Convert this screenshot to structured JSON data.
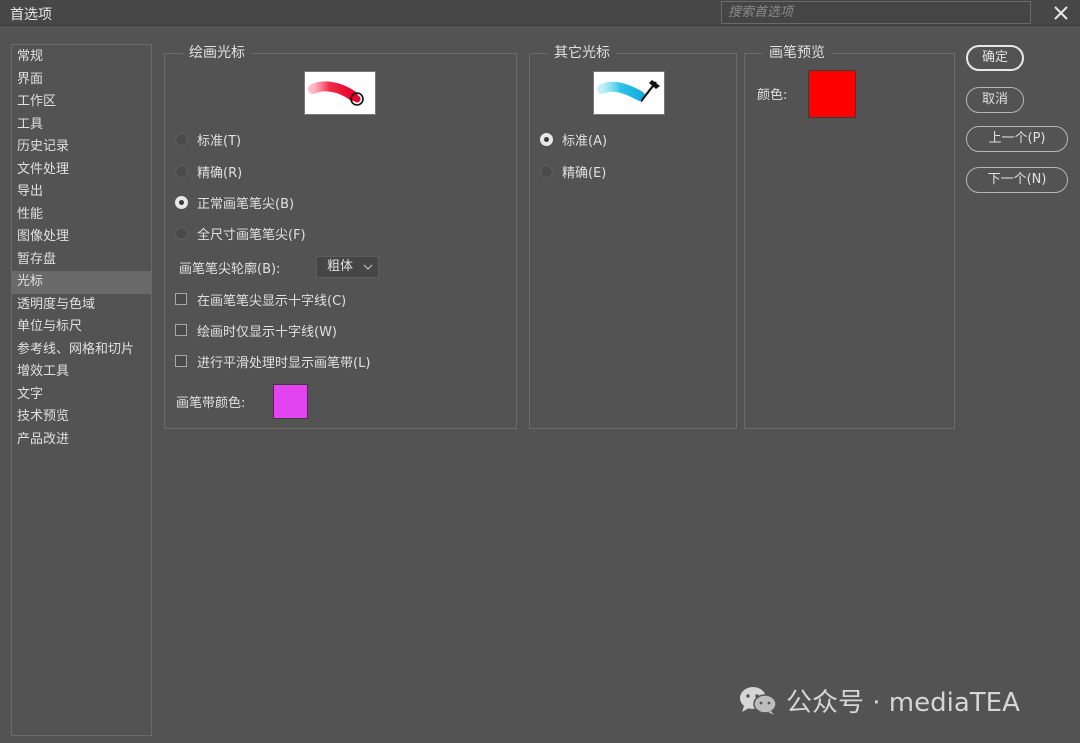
{
  "window": {
    "title": "首选项",
    "search_placeholder": "搜索首选项"
  },
  "sidebar": {
    "items": [
      {
        "label": "常规"
      },
      {
        "label": "界面"
      },
      {
        "label": "工作区"
      },
      {
        "label": "工具"
      },
      {
        "label": "历史记录"
      },
      {
        "label": "文件处理"
      },
      {
        "label": "导出"
      },
      {
        "label": "性能"
      },
      {
        "label": "图像处理"
      },
      {
        "label": "暂存盘"
      },
      {
        "label": "光标",
        "selected": true
      },
      {
        "label": "透明度与色域"
      },
      {
        "label": "单位与标尺"
      },
      {
        "label": "参考线、网格和切片"
      },
      {
        "label": "增效工具"
      },
      {
        "label": "文字"
      },
      {
        "label": "技术预览"
      },
      {
        "label": "产品改进"
      }
    ]
  },
  "painting_cursors": {
    "title": "绘画光标",
    "preview_icon": "brush-stroke-preview-red",
    "options": [
      {
        "label": "标准(T)",
        "checked": false
      },
      {
        "label": "精确(R)",
        "checked": false
      },
      {
        "label": "正常画笔笔尖(B)",
        "checked": true
      },
      {
        "label": "全尺寸画笔笔尖(F)",
        "checked": false
      }
    ],
    "brush_tip_outline_label": "画笔笔尖轮廓(B):",
    "brush_tip_outline_value": "粗体",
    "checkboxes": [
      {
        "label": "在画笔笔尖显示十字线(C)",
        "checked": false
      },
      {
        "label": "绘画时仅显示十字线(W)",
        "checked": false
      },
      {
        "label": "进行平滑处理时显示画笔带(L)",
        "checked": false
      }
    ],
    "brush_leash_color_label": "画笔带颜色:",
    "brush_leash_color": "#e245f0"
  },
  "other_cursors": {
    "title": "其它光标",
    "preview_icon": "eyedropper-stroke-preview-cyan",
    "options": [
      {
        "label": "标准(A)",
        "checked": true
      },
      {
        "label": "精确(E)",
        "checked": false
      }
    ]
  },
  "brush_preview": {
    "title": "画笔预览",
    "color_label": "颜色:",
    "color": "#ff0000"
  },
  "buttons": {
    "ok": "确定",
    "cancel": "取消",
    "prev": "上一个(P)",
    "next": "下一个(N)"
  },
  "watermark": {
    "text": "公众号 · mediaTEA",
    "icon": "wechat-icon"
  }
}
